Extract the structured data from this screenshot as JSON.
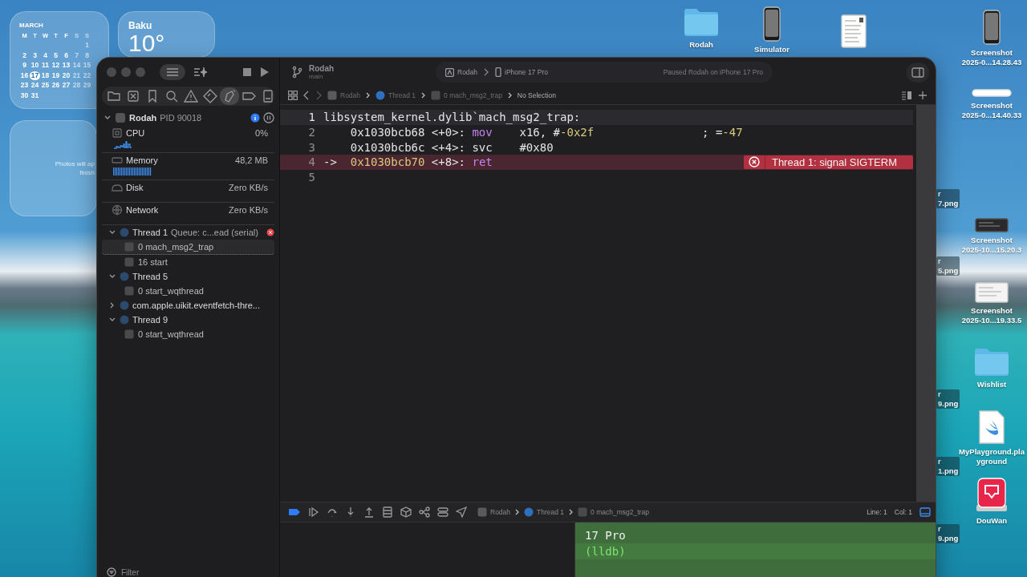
{
  "desktop": {
    "calendar": {
      "month": "MARCH",
      "weekdays": [
        "M",
        "T",
        "W",
        "T",
        "F",
        "S",
        "S"
      ],
      "weeks": [
        [
          {
            "text": "1",
            "today": false
          }
        ],
        [
          {
            "text": "2",
            "today": false
          },
          {
            "text": "3",
            "today": false
          },
          {
            "text": "4",
            "today": false
          },
          {
            "text": "5",
            "today": false
          },
          {
            "text": "6",
            "today": false
          },
          {
            "text": "7",
            "today": false
          },
          {
            "text": "8",
            "today": false
          }
        ],
        [
          {
            "text": "9",
            "today": false
          },
          {
            "text": "10",
            "today": false
          },
          {
            "text": "11",
            "today": false
          },
          {
            "text": "12",
            "today": false
          },
          {
            "text": "13",
            "today": false
          },
          {
            "text": "14",
            "today": false
          },
          {
            "text": "15",
            "today": false
          }
        ],
        [
          {
            "text": "16",
            "today": false
          },
          {
            "text": "17",
            "today": true
          },
          {
            "text": "18",
            "today": false
          },
          {
            "text": "19",
            "today": false
          },
          {
            "text": "20",
            "today": false
          },
          {
            "text": "21",
            "today": false
          },
          {
            "text": "22",
            "today": false
          }
        ],
        [
          {
            "text": "23",
            "today": false
          },
          {
            "text": "24",
            "today": false
          },
          {
            "text": "25",
            "today": false
          },
          {
            "text": "26",
            "today": false
          },
          {
            "text": "27",
            "today": false
          },
          {
            "text": "28",
            "today": false
          },
          {
            "text": "29",
            "today": false
          }
        ],
        [
          {
            "text": "30",
            "today": false
          },
          {
            "text": "31",
            "today": false
          }
        ]
      ]
    },
    "weather": {
      "city": "Baku",
      "temperature": "10°"
    },
    "photos": {
      "lines": [
        "Photos will ap",
        "finish"
      ]
    },
    "icons": [
      {
        "kind": "folder",
        "lines": [
          "Rodah"
        ]
      },
      {
        "kind": "phone",
        "lines": [
          "Simulator"
        ]
      },
      {
        "kind": "document"
      },
      {
        "kind": "phone",
        "lines": [
          "Screenshot",
          "2025-0...14.28.43"
        ]
      },
      {
        "kind": "bar",
        "lines": [
          "Screenshot",
          "2025-0...14.40.33"
        ]
      },
      {
        "kind": "dark-shot",
        "lines": [
          "Screenshot",
          "2025-10...15.20.3"
        ]
      },
      {
        "kind": "light-shot",
        "lines": [
          "Screenshot",
          "2025-10...19.33.5"
        ]
      },
      {
        "kind": "folder",
        "lines": [
          "Wishlist"
        ]
      },
      {
        "kind": "swift",
        "lines": [
          "MyPlayground.pla",
          "yground"
        ]
      },
      {
        "kind": "app",
        "lines": [
          "DouWan"
        ]
      }
    ],
    "cut_labels": [
      {
        "lines": [
          "r",
          "7.png"
        ]
      },
      {
        "lines": [
          "r",
          "5.png"
        ]
      },
      {
        "lines": [
          "r",
          "9.png"
        ]
      },
      {
        "lines": [
          "r",
          "1.png"
        ]
      },
      {
        "lines": [
          "r",
          "9.png"
        ]
      }
    ]
  },
  "window": {
    "toolbar": {
      "scheme": "Rodah",
      "branch": "main",
      "destination_app": "Rodah",
      "destination_device": "iPhone 17 Pro",
      "status": "Paused Rodah on iPhone 17 Pro"
    },
    "navigator_tabs": [
      {
        "selected": false
      },
      {
        "selected": false
      },
      {
        "selected": false
      },
      {
        "selected": false
      },
      {
        "selected": false
      },
      {
        "selected": false
      },
      {
        "selected": true
      },
      {
        "selected": false
      },
      {
        "selected": false
      }
    ],
    "process": {
      "name": "Rodah",
      "pid": "PID 90018",
      "expanded": true
    },
    "gauges": [
      {
        "kind": "cpu",
        "label": "CPU",
        "value": "0%"
      },
      {
        "kind": "memory",
        "label": "Memory",
        "value": "48,2 MB"
      },
      {
        "kind": "disk",
        "label": "Disk",
        "value": "Zero KB/s"
      },
      {
        "kind": "network",
        "label": "Network",
        "value": "Zero KB/s"
      }
    ],
    "threads": [
      {
        "name": "Thread 1",
        "detail": "Queue: c...ead (serial)",
        "expanded": true,
        "error": true,
        "children": [
          {
            "text": "0 mach_msg2_trap",
            "selected": true
          },
          {
            "text": "16 start",
            "selected": false
          }
        ]
      },
      {
        "name": "Thread 5",
        "expanded": true,
        "error": false,
        "children": [
          {
            "text": "0 start_wqthread",
            "selected": false
          }
        ]
      },
      {
        "name": "com.apple.uikit.eventfetch-thre...",
        "expanded": false,
        "error": false
      },
      {
        "name": "Thread 9",
        "expanded": true,
        "error": false,
        "children": [
          {
            "text": "0 start_wqthread",
            "selected": false
          }
        ]
      }
    ],
    "filter": {
      "placeholder": "Filter"
    },
    "jump_bar": [
      {
        "kind": "app",
        "text": "Rodah"
      },
      {
        "kind": "thread",
        "text": "Thread 1"
      },
      {
        "kind": "frame",
        "text": "0 mach_msg2_trap"
      },
      {
        "kind": "plain",
        "text": "No Selection"
      }
    ],
    "code": [
      {
        "number": "1",
        "cursor": true,
        "current": false,
        "tokens": [
          {
            "kind": "plain",
            "text": "libsystem_kernel.dylib`mach_msg2_trap:"
          }
        ]
      },
      {
        "number": "2",
        "cursor": false,
        "current": false,
        "tokens": [
          {
            "kind": "plain",
            "text": "    0x1030bcb68 <+0>: "
          },
          {
            "kind": "keyword",
            "text": "mov"
          },
          {
            "kind": "plain",
            "text": "    x16, #"
          },
          {
            "kind": "number",
            "text": "-0x2f"
          },
          {
            "kind": "plain",
            "text": "                ; ="
          },
          {
            "kind": "number",
            "text": "-47"
          }
        ]
      },
      {
        "number": "3",
        "cursor": false,
        "current": false,
        "tokens": [
          {
            "kind": "plain",
            "text": "    0x1030bcb6c <+4>: svc    #0x80"
          }
        ]
      },
      {
        "number": "4",
        "cursor": false,
        "current": true,
        "annotation": "Thread 1: signal SIGTERM",
        "tokens": [
          {
            "kind": "plain",
            "text": "->  "
          },
          {
            "kind": "number",
            "text": "0x1030bcb70"
          },
          {
            "kind": "plain",
            "text": " <+8>: "
          },
          {
            "kind": "keyword",
            "text": "ret"
          }
        ]
      },
      {
        "number": "5",
        "cursor": false,
        "current": false
      }
    ],
    "debug_bar": {
      "breakpoints_active": true,
      "crumbs": [
        {
          "kind": "app",
          "text": "Rodah"
        },
        {
          "kind": "thread",
          "text": "Thread 1"
        },
        {
          "kind": "frame",
          "text": "0 mach_msg2_trap"
        }
      ],
      "line": "Line: 1",
      "col": "Col: 1"
    },
    "console": [
      {
        "kind": "output",
        "text": "17 Pro"
      },
      {
        "kind": "prompt",
        "text": "(lldb)"
      }
    ]
  }
}
